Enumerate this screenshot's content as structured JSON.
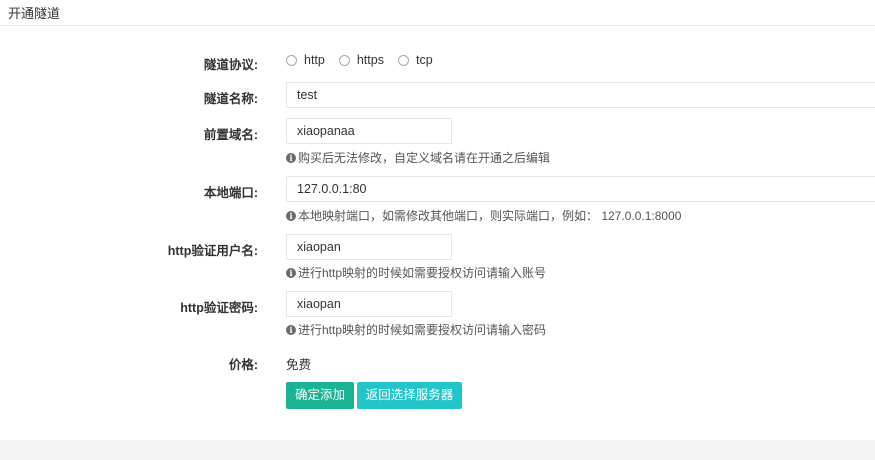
{
  "header": {
    "title": "开通隧道"
  },
  "form": {
    "protocol": {
      "label": "隧道协议:",
      "options": [
        "http",
        "https",
        "tcp"
      ]
    },
    "tunnel_name": {
      "label": "隧道名称:",
      "value": "test"
    },
    "prefix_domain": {
      "label": "前置域名:",
      "value": "xiaopanaa",
      "help": "购买后无法修改，自定义域名请在开通之后编辑"
    },
    "local_port": {
      "label": "本地端口:",
      "value": "127.0.0.1:80",
      "help": "本地映射端口，如需修改其他端口，则实际端口，例如： 127.0.0.1:8000"
    },
    "http_user": {
      "label": "http验证用户名:",
      "value": "xiaopan",
      "help": "进行http映射的时候如需要授权访问请输入账号"
    },
    "http_password": {
      "label": "http验证密码:",
      "value": "xiaopan",
      "help": "进行http映射的时候如需要授权访问请输入密码"
    },
    "price": {
      "label": "价格:",
      "value": "免费"
    }
  },
  "buttons": {
    "confirm": "确定添加",
    "back": "返回选择服务器"
  },
  "colors": {
    "primary": "#1ab394",
    "info": "#23c6c8",
    "footer": "#f3f3f4"
  },
  "icons": {
    "help": "info-circle-icon"
  }
}
